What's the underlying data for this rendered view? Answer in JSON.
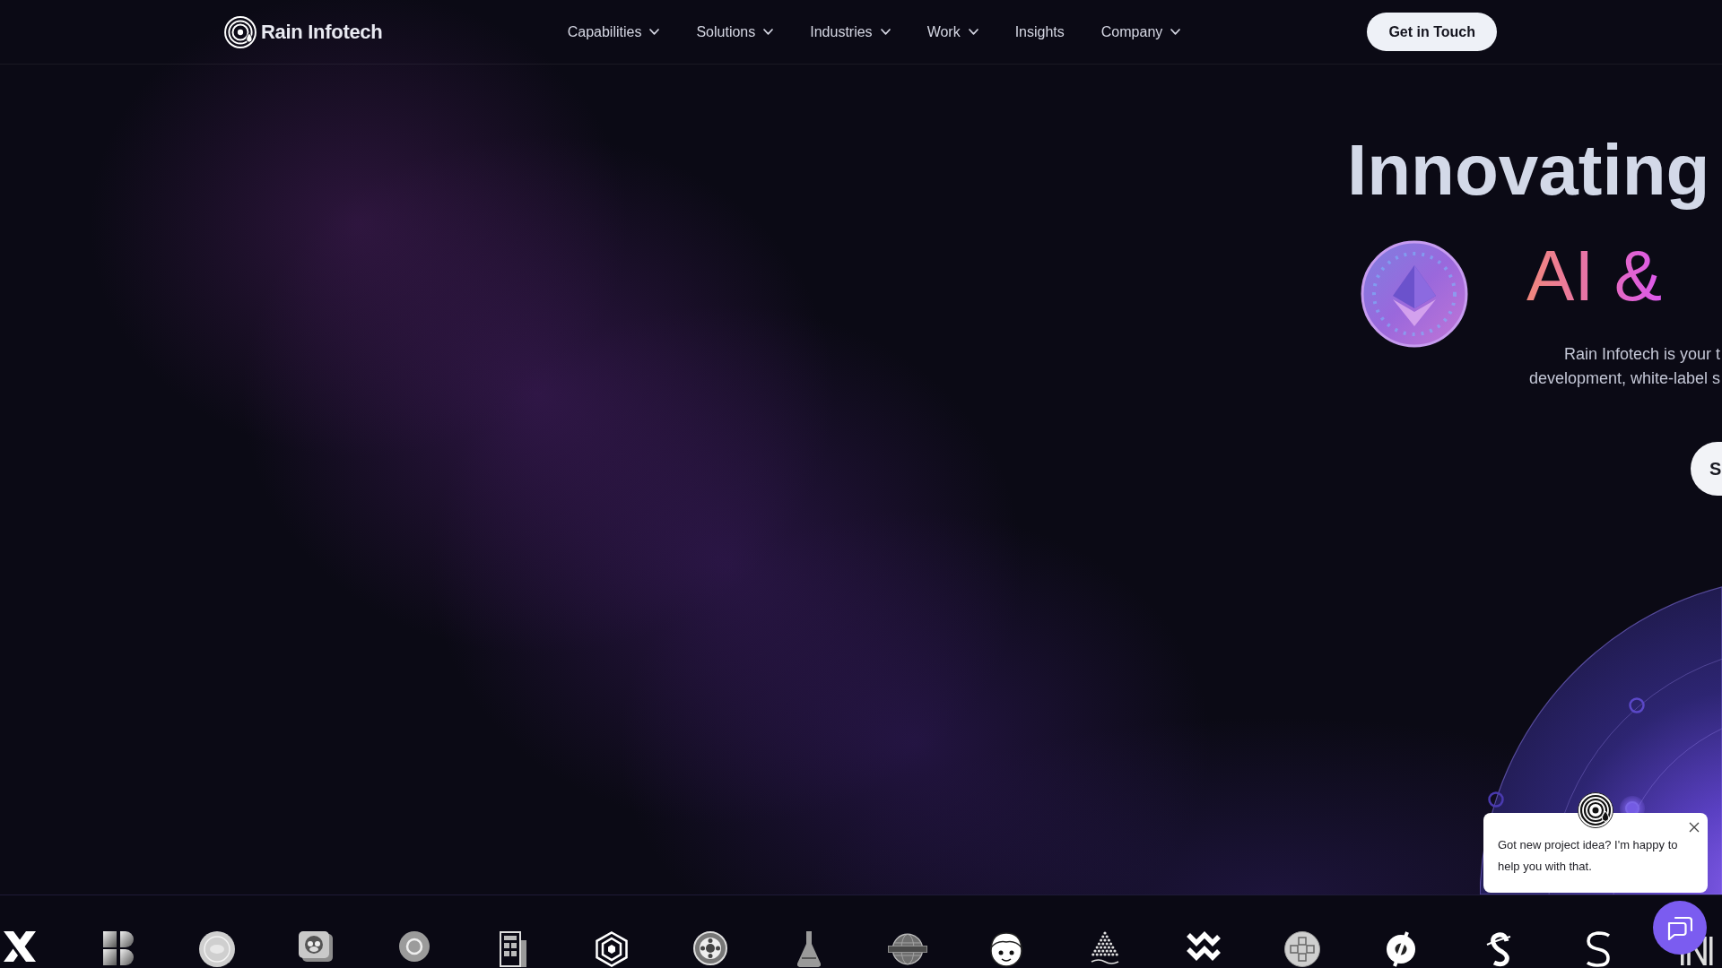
{
  "nav": {
    "brand": "Rain Infotech",
    "links": [
      {
        "label": "Capabilities",
        "dropdown": true
      },
      {
        "label": "Solutions",
        "dropdown": true
      },
      {
        "label": "Industries",
        "dropdown": true
      },
      {
        "label": "Work",
        "dropdown": true
      },
      {
        "label": "Insights",
        "dropdown": false
      },
      {
        "label": "Company",
        "dropdown": true
      }
    ],
    "cta": "Get in Touch"
  },
  "hero": {
    "headline": "Innovating",
    "highlight": "AI &",
    "description": "Rain Infotech is your t\ndevelopment, white-label s",
    "button": "S"
  },
  "chat": {
    "message": "Got new project idea? I'm happy to help you with that."
  }
}
